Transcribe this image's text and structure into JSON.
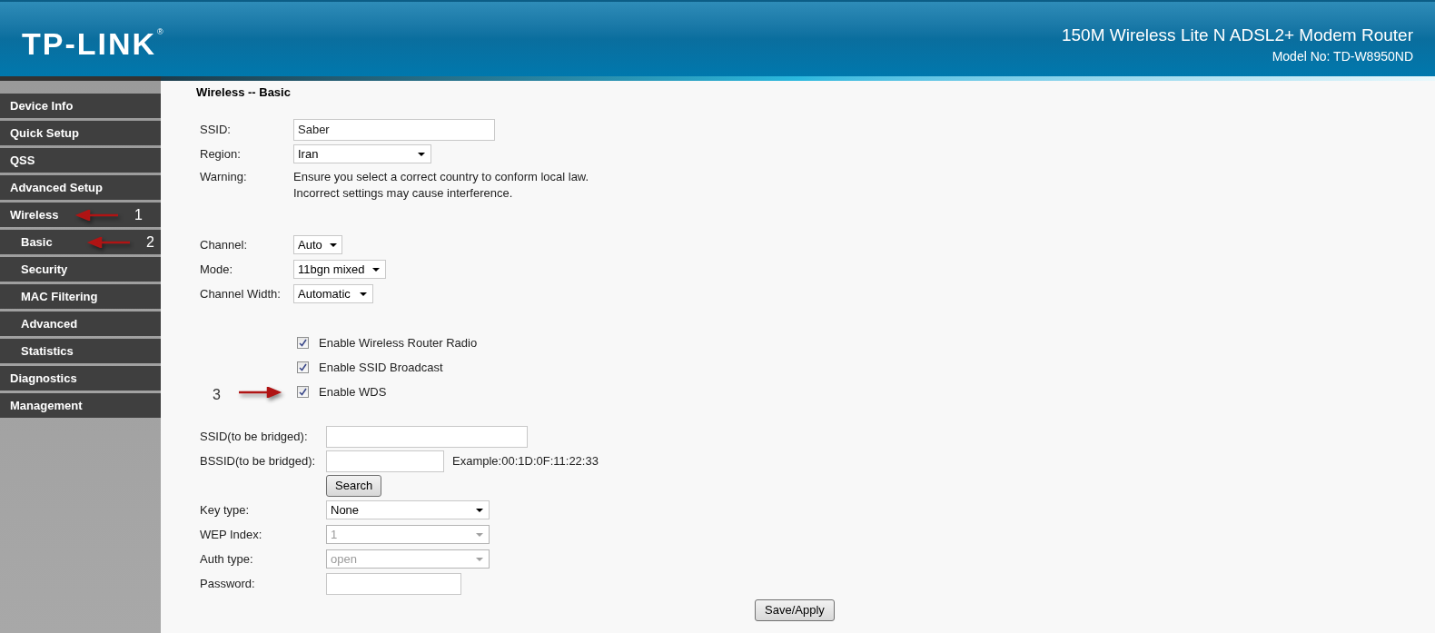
{
  "header": {
    "logo": "TP-LINK",
    "registered_mark": "®",
    "title": "150M Wireless Lite N ADSL2+ Modem Router",
    "model": "Model No: TD-W8950ND"
  },
  "sidebar": {
    "items": [
      {
        "label": "Device Info"
      },
      {
        "label": "Quick Setup"
      },
      {
        "label": "QSS"
      },
      {
        "label": "Advanced Setup"
      },
      {
        "label": "Wireless",
        "annotation": "1",
        "children": [
          {
            "label": "Basic",
            "annotation": "2"
          },
          {
            "label": "Security"
          },
          {
            "label": "MAC Filtering"
          },
          {
            "label": "Advanced"
          },
          {
            "label": "Statistics"
          }
        ]
      },
      {
        "label": "Diagnostics"
      },
      {
        "label": "Management"
      }
    ]
  },
  "page_title": "Wireless -- Basic",
  "basic_fields": [
    {
      "kind": "text",
      "label": "SSID:",
      "value": "Saber"
    },
    {
      "kind": "select",
      "label": "Region:",
      "value": "Iran"
    },
    {
      "kind": "note",
      "label": "Warning:",
      "lines": [
        "Ensure you select a correct country to conform local law.",
        "Incorrect settings may cause interference."
      ]
    }
  ],
  "radio_fields": [
    {
      "kind": "select",
      "label": "Channel:",
      "value": "Auto"
    },
    {
      "kind": "select",
      "label": "Mode:",
      "value": "11bgn mixed"
    },
    {
      "kind": "select",
      "label": "Channel Width:",
      "value": "Automatic"
    }
  ],
  "checkboxes": [
    {
      "label": "Enable Wireless Router Radio",
      "checked": true
    },
    {
      "label": "Enable SSID Broadcast",
      "checked": true
    },
    {
      "label": "Enable WDS",
      "checked": true,
      "annotation": "3"
    }
  ],
  "wds_fields": [
    {
      "kind": "text",
      "label": "SSID(to be bridged):"
    },
    {
      "kind": "text",
      "label": "BSSID(to be bridged):",
      "hint": "Example:00:1D:0F:11:22:33"
    },
    {
      "kind": "button",
      "label": "Search"
    },
    {
      "kind": "select",
      "label": "Key type:",
      "value": "None",
      "disabled": false
    },
    {
      "kind": "select",
      "label": "WEP Index:",
      "value": "1",
      "disabled": true
    },
    {
      "kind": "select",
      "label": "Auth type:",
      "value": "open",
      "disabled": true
    },
    {
      "kind": "password",
      "label": "Password:"
    }
  ],
  "save_button": "Save/Apply"
}
